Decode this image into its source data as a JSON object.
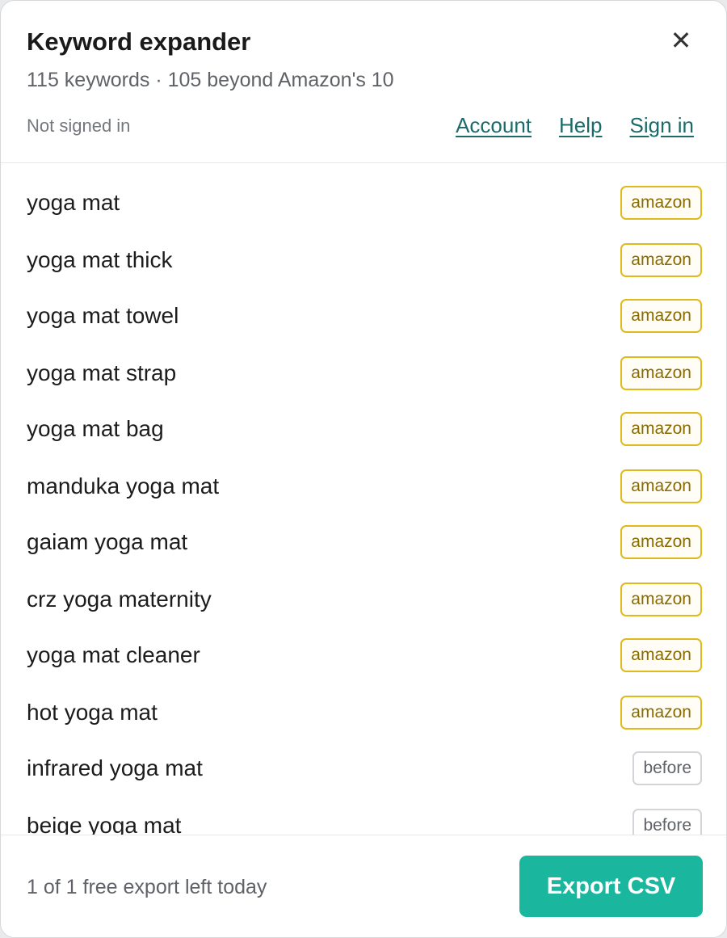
{
  "header": {
    "title": "Keyword expander",
    "subtitle": "115 keywords · 105 beyond Amazon's 10",
    "close_icon": "close-icon",
    "close_glyph": "✕",
    "status": "Not signed in",
    "links": [
      "Account",
      "Help",
      "Sign in"
    ]
  },
  "keywords": [
    {
      "text": "yoga mat",
      "badge": "amazon"
    },
    {
      "text": "yoga mat thick",
      "badge": "amazon"
    },
    {
      "text": "yoga mat towel",
      "badge": "amazon"
    },
    {
      "text": "yoga mat strap",
      "badge": "amazon"
    },
    {
      "text": "yoga mat bag",
      "badge": "amazon"
    },
    {
      "text": "manduka yoga mat",
      "badge": "amazon"
    },
    {
      "text": "gaiam yoga mat",
      "badge": "amazon"
    },
    {
      "text": "crz yoga maternity",
      "badge": "amazon"
    },
    {
      "text": "yoga mat cleaner",
      "badge": "amazon"
    },
    {
      "text": "hot yoga mat",
      "badge": "amazon"
    },
    {
      "text": "infrared yoga mat",
      "badge": "before"
    },
    {
      "text": "beige yoga mat",
      "badge": "before"
    }
  ],
  "footer": {
    "note": "1 of 1 free export left today",
    "export_label": "Export CSV"
  },
  "colors": {
    "accent": "#1ab69d",
    "link": "#1b6b6b",
    "amazon_badge": "#e0b91c",
    "before_badge": "#d2d4d7"
  }
}
